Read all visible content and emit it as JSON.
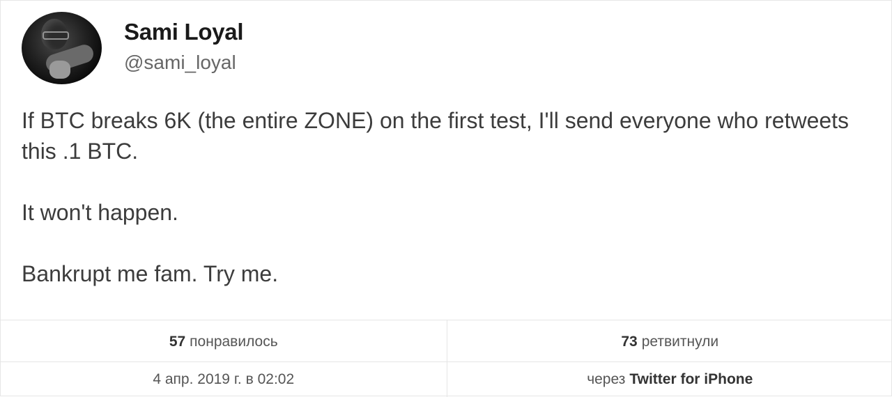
{
  "user": {
    "display_name": "Sami Loyal",
    "handle": "@sami_loyal"
  },
  "tweet": {
    "paragraphs": [
      "If BTC breaks 6K (the entire ZONE) on the first test, I'll send everyone who retweets this .1 BTC.",
      "It won't happen.",
      "Bankrupt me fam. Try me."
    ]
  },
  "stats": {
    "likes_count": "57",
    "likes_label": "понравилось",
    "retweets_count": "73",
    "retweets_label": "ретвитнули"
  },
  "meta": {
    "timestamp": "4 апр. 2019 г. в 02:02",
    "source_prefix": "через",
    "source_name": "Twitter for iPhone"
  }
}
